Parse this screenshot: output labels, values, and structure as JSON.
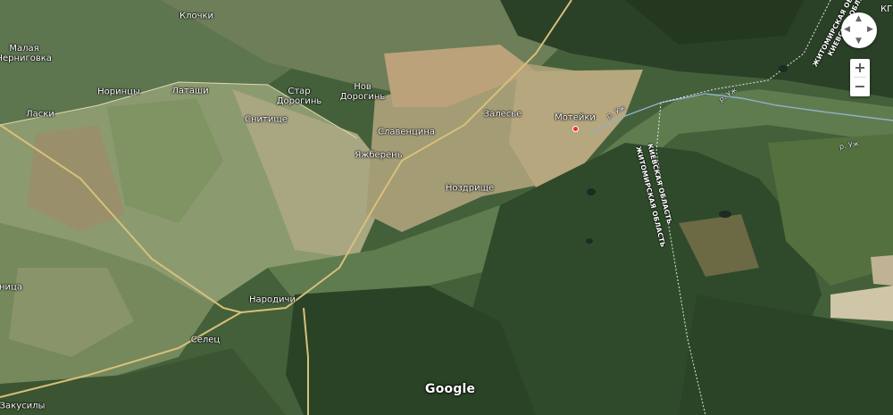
{
  "map": {
    "places": {
      "malaya_chernigovka": "Малая\nЧерниговка",
      "klochki": "Клочки",
      "norintsy": "Норинцы",
      "latashi": "Латаши",
      "star_doroginy": "Стар\nДорогинь",
      "nov_doroginy": "Нов\nДорогинь",
      "laski": "Ласки",
      "snitische": "Снитище",
      "slaventsyna": "Славенцина",
      "zalesye": "Залесье",
      "moteyki": "Мотейки",
      "yazhberen": "Яжберень",
      "nozdrische": "Ноздрище",
      "narodichi": "Народичи",
      "selets": "Селец",
      "zakusily": "Закусилы",
      "nitsa": "ница"
    },
    "rivers": {
      "uzh_1": "р. Уж",
      "uzh_2": "р. Уж",
      "uzh_3": "р. Уж"
    },
    "boundaries": {
      "zhytomyr_top": "ЖИТОМИРСКАЯ ОБ.",
      "kyiv_top": "КИЕВСКАЯ ОБЛ.",
      "kyiv_mid": "КИЕВСКАЯ ОБЛАСТЬ",
      "zhytomyr_mid": "ЖИТОМИРСКАЯ ОБЛАСТЬ"
    },
    "corner_label": "КГ"
  },
  "attribution": {
    "logo": "Google"
  },
  "controls": {
    "zoom_in": "+",
    "zoom_out": "−",
    "pan_up": "▲",
    "pan_down": "▼",
    "pan_left": "◀",
    "pan_right": "▶"
  },
  "colors": {
    "forest": "#2e4a2c",
    "field_light": "#b7ab86",
    "field_green": "#7e9468",
    "road": "#d8c07a",
    "marker": "#e8312a"
  }
}
